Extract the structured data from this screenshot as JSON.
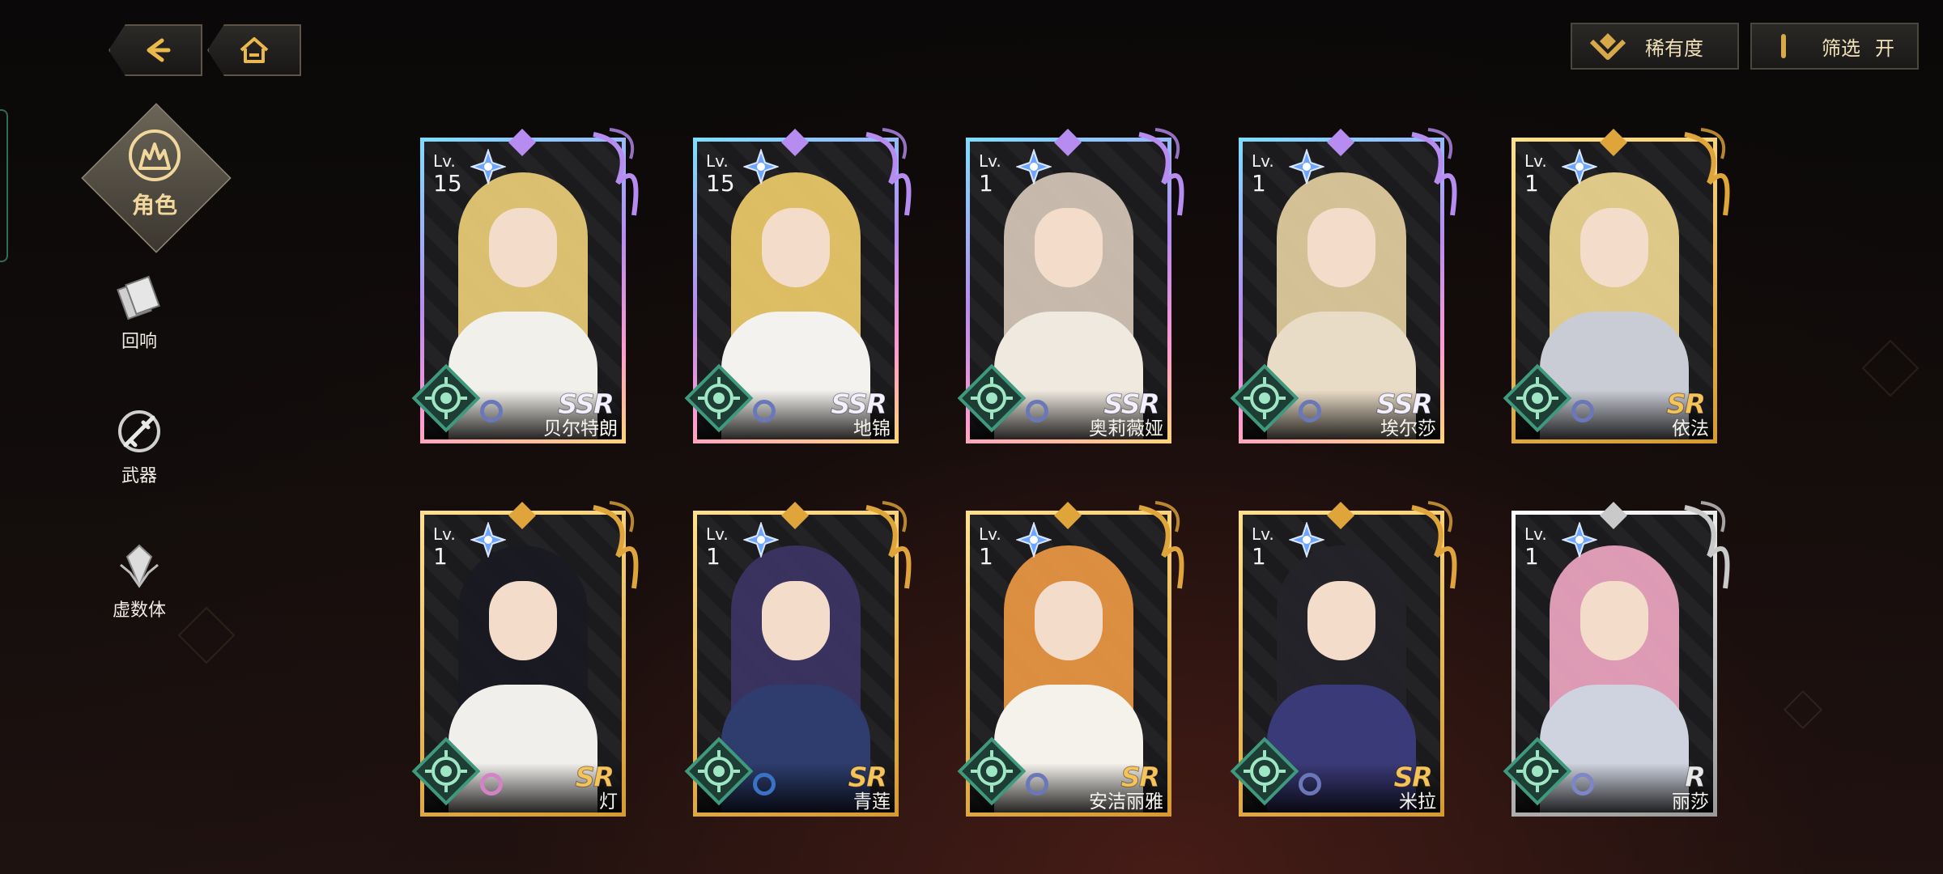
{
  "nav": {
    "back_icon": "back-arrow-icon",
    "home_icon": "home-icon"
  },
  "sidebar": {
    "active": {
      "label": "角色",
      "icon": "character-icon"
    },
    "items": [
      {
        "label": "回响",
        "icon": "echo-card-icon"
      },
      {
        "label": "武器",
        "icon": "weapon-icon"
      },
      {
        "label": "虚数体",
        "icon": "imaginary-body-icon"
      }
    ]
  },
  "toolbar": {
    "sort_label": "稀有度",
    "sort_icon": "sort-chevron-icon",
    "filter_label": "筛选",
    "filter_state": "开"
  },
  "lv_prefix": "Lv.",
  "characters": [
    {
      "name": "贝尔特朗",
      "level": "15",
      "rarity": "SSR"
    },
    {
      "name": "地锦",
      "level": "15",
      "rarity": "SSR"
    },
    {
      "name": "奥莉薇娅",
      "level": "1",
      "rarity": "SSR"
    },
    {
      "name": "埃尔莎",
      "level": "1",
      "rarity": "SSR"
    },
    {
      "name": "依法",
      "level": "1",
      "rarity": "SR"
    },
    {
      "name": "灯",
      "level": "1",
      "rarity": "SR"
    },
    {
      "name": "青莲",
      "level": "1",
      "rarity": "SR"
    },
    {
      "name": "安洁丽雅",
      "level": "1",
      "rarity": "SR"
    },
    {
      "name": "米拉",
      "level": "1",
      "rarity": "SR"
    },
    {
      "name": "丽莎",
      "level": "1",
      "rarity": "R"
    }
  ],
  "colors": {
    "ssr_frame": "#b78cf0",
    "sr_frame": "#e0a53a",
    "r_frame": "#c9c9c9",
    "element": "#3f9a7d",
    "accent_gold": "#f1d79c"
  }
}
